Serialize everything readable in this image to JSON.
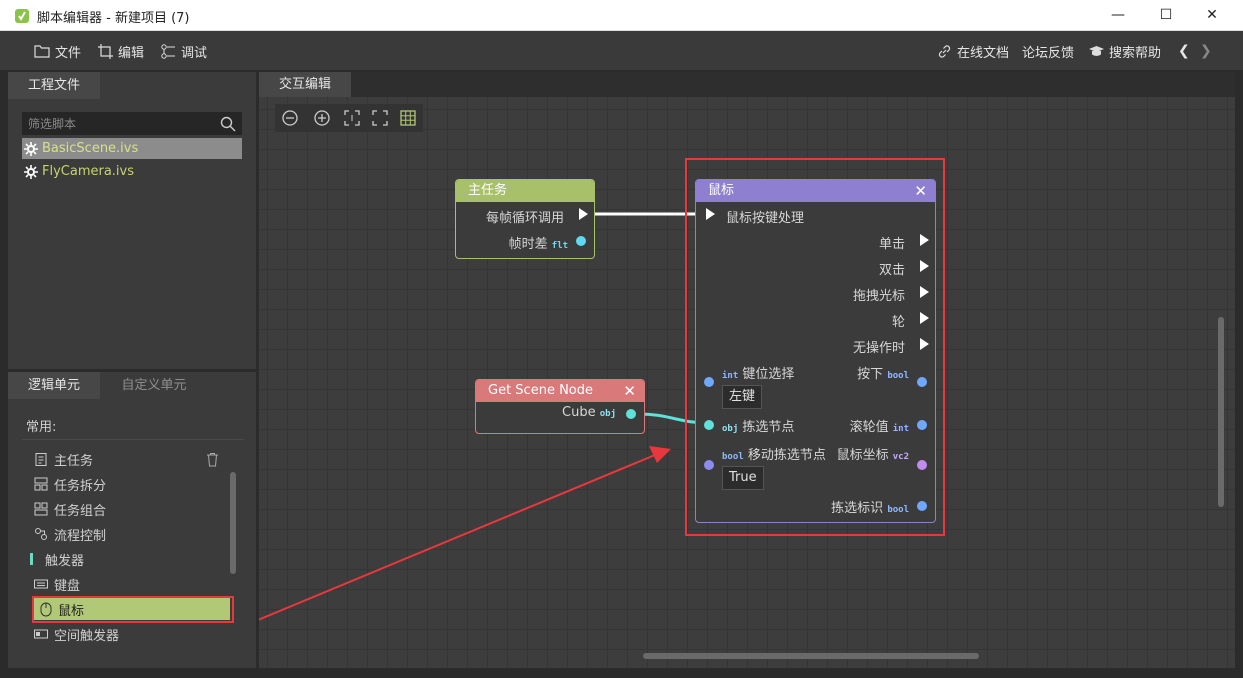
{
  "window": {
    "title": "脚本编辑器 - 新建项目 (7)",
    "minimize": "—",
    "maximize": "☐",
    "close": "✕"
  },
  "menu": {
    "file": "文件",
    "edit": "编辑",
    "debug": "调试",
    "online_docs": "在线文档",
    "forum": "论坛反馈",
    "help": "搜索帮助",
    "prev": "❮",
    "next": "❯"
  },
  "project_panel": {
    "tab_label": "工程文件",
    "filter_placeholder": "筛选脚本",
    "files": [
      "BasicScene.ivs",
      "FlyCamera.ivs"
    ]
  },
  "units_panel": {
    "tabs": [
      "逻辑单元",
      "自定义单元"
    ],
    "section": "常用:",
    "items": [
      "主任务",
      "任务拆分",
      "任务组合",
      "流程控制",
      "触发器",
      "键盘",
      "鼠标",
      "空间触发器"
    ],
    "selected": "鼠标"
  },
  "editor": {
    "tab_label": "交互编辑"
  },
  "nodes": {
    "main_task": {
      "title": "主任务",
      "out_exec": "每帧循环调用",
      "out_delta": "帧时差",
      "out_delta_type": "flt"
    },
    "get_scene_node": {
      "title": "Get Scene Node",
      "out_cube": "Cube",
      "out_cube_type": "obj"
    },
    "mouse": {
      "title": "鼠标",
      "in_exec": "鼠标按键处理",
      "out_click": "单击",
      "out_dblclick": "双击",
      "out_drag": "拖拽光标",
      "out_wheel": "轮",
      "out_idle": "无操作时",
      "in_key_type": "int",
      "in_key": "键位选择",
      "in_key_value": "左键",
      "out_pressed": "按下",
      "out_pressed_type": "bool",
      "in_pick_type": "obj",
      "in_pick": "拣选节点",
      "out_wheel_val": "滚轮值",
      "out_wheel_val_type": "int",
      "in_move_type": "bool",
      "in_move": "移动拣选节点",
      "in_move_value": "True",
      "out_coord": "鼠标坐标",
      "out_coord_type": "vc2",
      "out_pick_flag": "拣选标识",
      "out_pick_flag_type": "bool"
    }
  },
  "colors": {
    "main_task_header": "#a9c06a",
    "scene_node_header": "#d9797a",
    "mouse_header": "#8f7fd0",
    "highlight_red": "#e8383d",
    "selected_unit": "#b1c877"
  }
}
